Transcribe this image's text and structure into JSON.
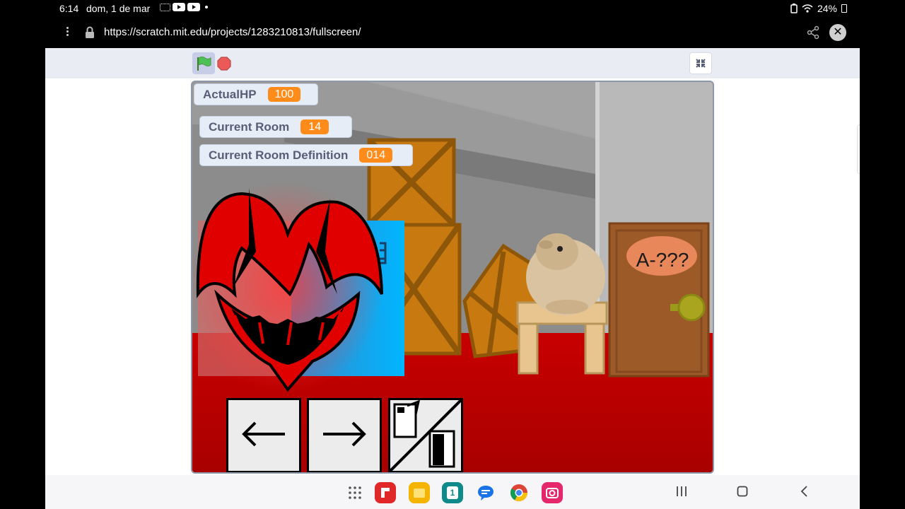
{
  "status_bar": {
    "time": "6:14",
    "date": "dom, 1 de mar",
    "battery": "24%"
  },
  "browser": {
    "url": "https://scratch.mit.edu/projects/1283210813/fullscreen/"
  },
  "monitors": {
    "actual_hp": {
      "label": "ActualHP",
      "value": "100"
    },
    "current_room": {
      "label": "Current Room",
      "value": "14"
    },
    "room_definition": {
      "label": "Current Room Definition",
      "value": "014"
    }
  },
  "scene": {
    "door_label": "A-???"
  },
  "colors": {
    "monitor_value": "#ff8c1a",
    "floor": "#c40000",
    "door": "#9c5a28"
  },
  "icons": {
    "toolbar": [
      "green-flag-icon",
      "stop-icon",
      "exit-fullscreen-icon"
    ],
    "nav_buttons": [
      "arrow-left-icon",
      "arrow-right-icon",
      "door-icon"
    ],
    "dock": [
      "apps-grid-icon",
      "flipboard-icon",
      "files-icon",
      "calendar-icon",
      "messages-icon",
      "chrome-icon",
      "camera-icon"
    ]
  },
  "dock": {
    "calendar_day": "1"
  }
}
